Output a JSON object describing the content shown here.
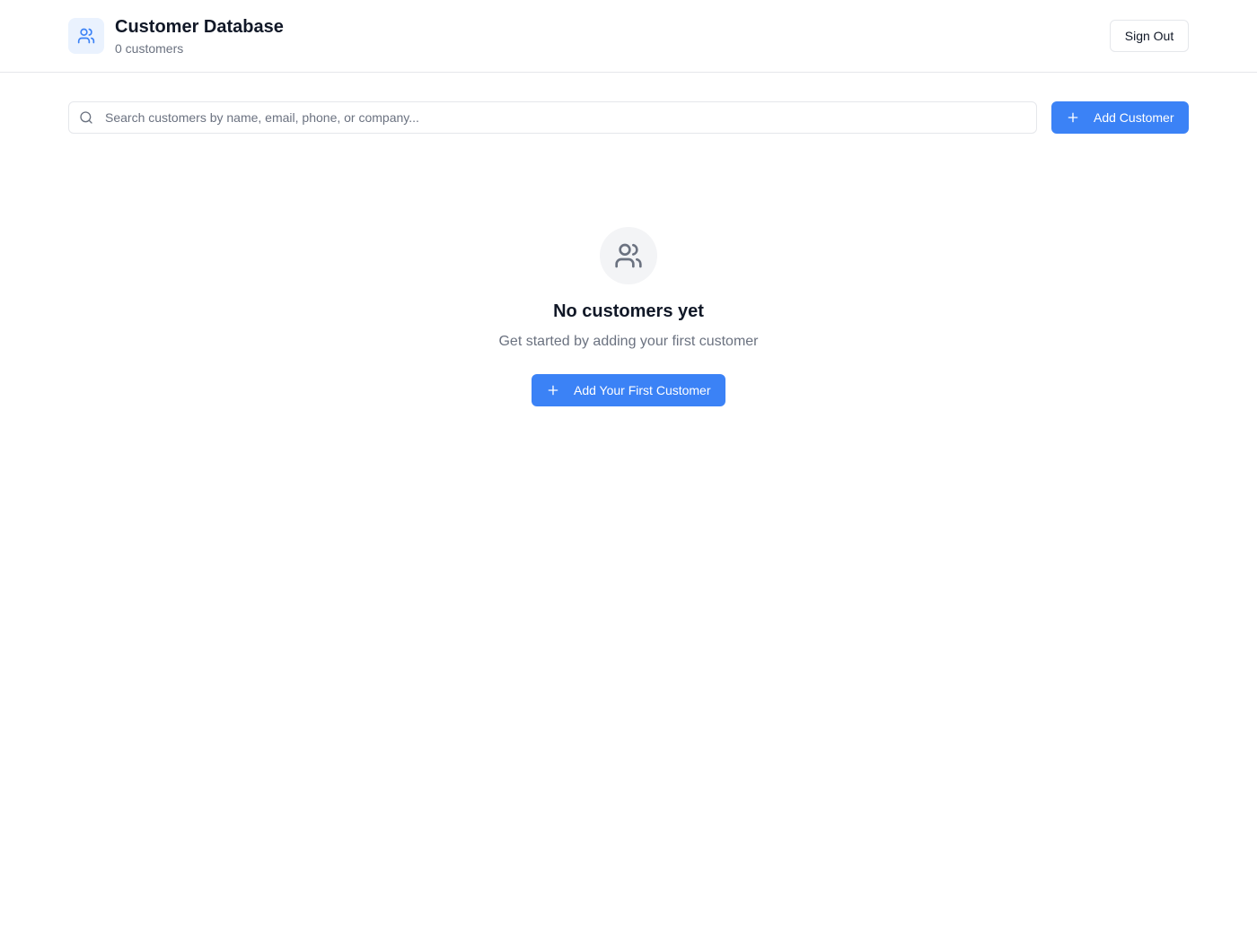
{
  "header": {
    "title": "Customer Database",
    "subtitle": "0 customers",
    "logo_icon": "users-icon",
    "sign_out_label": "Sign Out"
  },
  "toolbar": {
    "search": {
      "placeholder": "Search customers by name, email, phone, or company...",
      "value": "",
      "icon": "search-icon"
    },
    "add_button": {
      "label": "Add Customer",
      "icon": "plus-icon"
    }
  },
  "empty_state": {
    "icon": "users-icon",
    "title": "No customers yet",
    "description": "Get started by adding your first customer",
    "button": {
      "label": "Add Your First Customer",
      "icon": "plus-icon"
    }
  },
  "colors": {
    "accent": "#3b82f6",
    "logo_bg": "#eaf2fe",
    "muted_text": "#6b7280",
    "border": "#e5e7eb"
  }
}
